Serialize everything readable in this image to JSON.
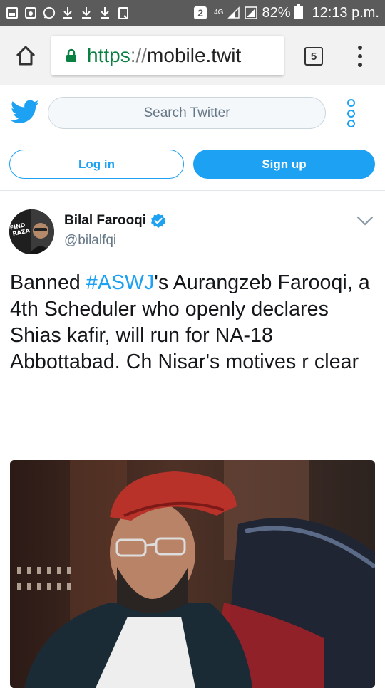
{
  "status_bar": {
    "left_icons": [
      "image-icon",
      "lock-app-icon",
      "whatsapp-icon",
      "download-icon",
      "download-icon",
      "download-icon",
      "clipboard-icon"
    ],
    "sim_badge": "2",
    "network": "4G",
    "battery": "82%",
    "time": "12:13 p.m."
  },
  "browser": {
    "url_scheme": "https",
    "url_separator": "://",
    "url_host": "mobile.twit",
    "tab_count": "5"
  },
  "twitter_header": {
    "search_placeholder": "Search Twitter",
    "login_label": "Log in",
    "signup_label": "Sign up"
  },
  "tweet": {
    "author_name": "Bilal Farooqi",
    "author_handle": "@bilalfqi",
    "verified": true,
    "avatar_caption": "FIND RAZA",
    "text_before": "Banned ",
    "hashtag": "#ASWJ",
    "text_after": "'s Aurangzeb Farooqi, a 4th Scheduler who openly declares Shias kafir, will run for NA-18 Abbottabad. Ch Nisar's motives r clear"
  },
  "colors": {
    "twitter_blue": "#1da1f2",
    "status_bar": "#5b5b5b",
    "chrome_bar": "#f2f2f2",
    "secure_green": "#0b8043"
  }
}
